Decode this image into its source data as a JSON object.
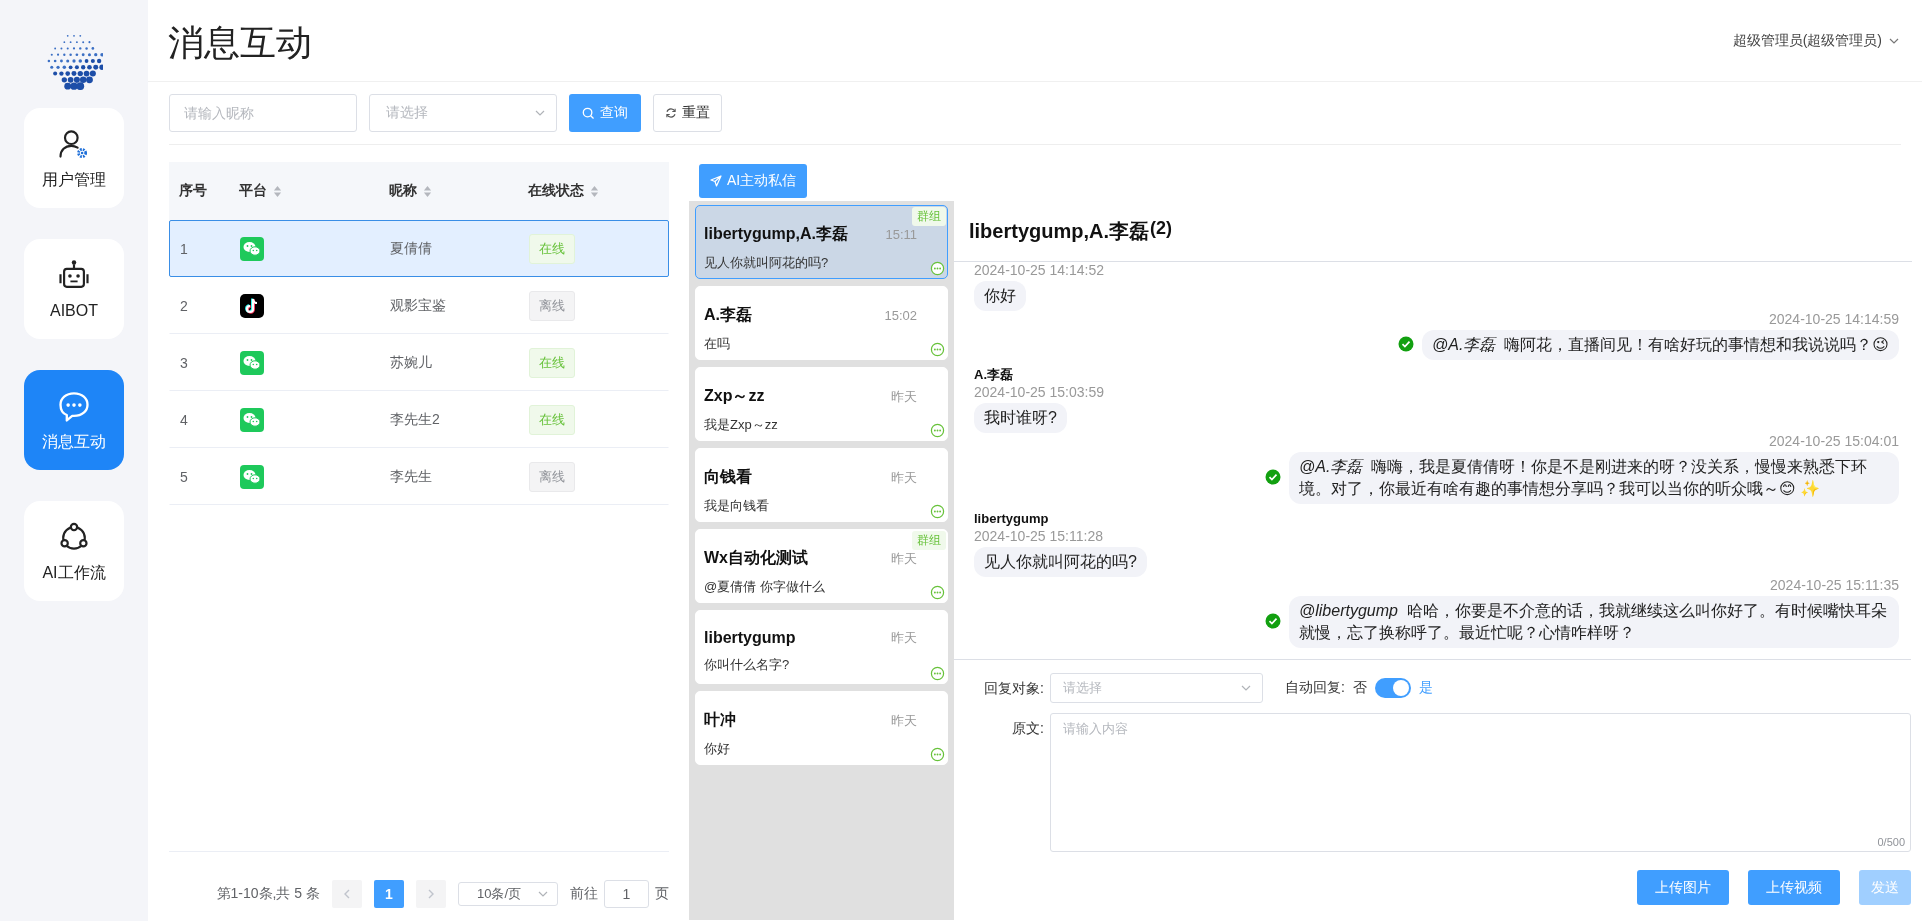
{
  "sidebar": {
    "items": [
      {
        "label": "用户管理",
        "kind": "user",
        "selected": false
      },
      {
        "label": "AIBOT",
        "kind": "robot",
        "selected": false
      },
      {
        "label": "消息互动",
        "kind": "chat",
        "selected": true
      },
      {
        "label": "AI工作流",
        "kind": "flow",
        "selected": false
      }
    ]
  },
  "header": {
    "title": "消息互动",
    "user_menu": "超级管理员(超级管理员)"
  },
  "filters": {
    "nickname": {
      "placeholder": "请输入昵称"
    },
    "platform": {
      "placeholder": "请选择"
    },
    "buttons": [
      {
        "label": "查询",
        "kind": "primary"
      },
      {
        "label": "重置",
        "kind": "default"
      }
    ]
  },
  "table": {
    "columns": [
      {
        "label": "序号",
        "sortable": false
      },
      {
        "label": "平台",
        "sortable": true
      },
      {
        "label": "昵称",
        "sortable": true
      },
      {
        "label": "在线状态",
        "sortable": true
      }
    ],
    "rows": [
      {
        "index": "1",
        "kind": "wechat",
        "nickname": "夏倩倩",
        "status": "在线",
        "online": true,
        "selected": true
      },
      {
        "index": "2",
        "kind": "tiktok",
        "nickname": "观影宝鉴",
        "status": "离线",
        "online": false,
        "selected": false
      },
      {
        "index": "3",
        "kind": "wechat",
        "nickname": "苏婉儿",
        "status": "在线",
        "online": true,
        "selected": false
      },
      {
        "index": "4",
        "kind": "wechat",
        "nickname": "李先生2",
        "status": "在线",
        "online": true,
        "selected": false
      },
      {
        "index": "5",
        "kind": "wechat",
        "nickname": "李先生",
        "status": "离线",
        "online": false,
        "selected": false
      }
    ]
  },
  "pagination": {
    "summary": "第1-10条,共 5 条",
    "prev_disabled": true,
    "next_disabled": true,
    "pages": [
      {
        "label": "1",
        "selected": true
      }
    ],
    "page_size": "10条/页",
    "goto_label": "前往",
    "goto_value": "1",
    "goto_suffix": "页"
  },
  "conversations": {
    "button": "AI主动私信",
    "items": [
      {
        "name": "libertygump,A.李磊",
        "time": "15:11",
        "preview": "见人你就叫阿花的吗?",
        "tag": "群组",
        "selected": true
      },
      {
        "name": "A.李磊",
        "time": "15:02",
        "preview": "在吗",
        "selected": false
      },
      {
        "name": "Zxp～zz",
        "time": "昨天",
        "preview": "我是Zxp～zz",
        "selected": false
      },
      {
        "name": "向钱看",
        "time": "昨天",
        "preview": "我是向钱看",
        "selected": false
      },
      {
        "name": "Wx自动化测试",
        "time": "昨天",
        "preview": "@夏倩倩 你字做什么",
        "tag": "群组",
        "selected": false
      },
      {
        "name": "libertygump",
        "time": "昨天",
        "preview": "你叫什么名字?",
        "selected": false
      },
      {
        "name": "叶冲",
        "time": "昨天",
        "preview": "你好",
        "selected": false
      }
    ]
  },
  "chat": {
    "title": "libertygump,A.李磊",
    "count": "(2)",
    "messages": [
      {
        "kind": "received",
        "time": "2024-10-25 14:14:52",
        "text": "你好"
      },
      {
        "kind": "sent",
        "time": "2024-10-25 14:14:59",
        "text": "*@A.李磊*  嗨阿花，直播间见！有啥好玩的事情想和我说说吗？😉",
        "sent": true
      },
      {
        "kind": "received",
        "sender": "A.李磊",
        "time": "2024-10-25 15:03:59",
        "text": "我时谁呀?"
      },
      {
        "kind": "sent",
        "time": "2024-10-25 15:04:01",
        "text": "*@A.李磊*  嗨嗨，我是夏倩倩呀！你是不是刚进来的呀？没关系，慢慢来熟悉下环境。对了，你最近有啥有趣的事情想分享吗？我可以当你的听众哦～😊 ✨",
        "sent": true
      },
      {
        "kind": "received",
        "sender": "libertygump",
        "time": "2024-10-25 15:11:28",
        "text": "见人你就叫阿花的吗?"
      },
      {
        "kind": "sent",
        "time": "2024-10-25 15:11:35",
        "text": "*@libertygump*  哈哈，你要是不介意的话，我就继续这么叫你好了。有时候嘴快耳朵就慢，忘了换称呼了。最近忙呢？心情咋样呀？",
        "sent": true
      }
    ]
  },
  "reply": {
    "target_label": "回复对象:",
    "target_placeholder": "请选择",
    "auto_reply": {
      "label": "自动回复:",
      "off_label": "否",
      "on_label": "是",
      "on": true
    },
    "text_label": "原文:",
    "text_placeholder": "请输入内容",
    "counter": "0/500",
    "buttons": [
      {
        "label": "上传图片",
        "disabled": false
      },
      {
        "label": "上传视频",
        "disabled": false
      },
      {
        "label": "发送",
        "disabled": true
      }
    ]
  }
}
